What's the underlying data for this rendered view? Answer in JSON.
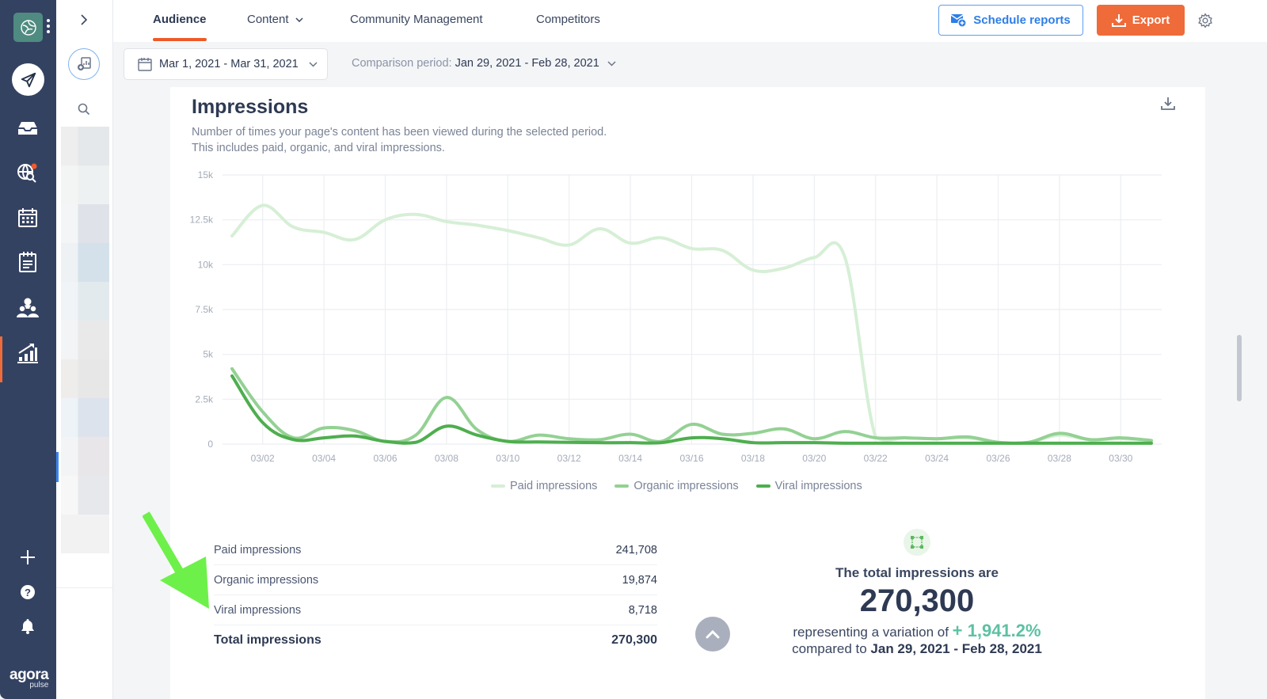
{
  "rail": {
    "brand_line1": "agora",
    "brand_line2": "pulse",
    "items": [
      {
        "name": "publish",
        "icon": "paper-plane-icon"
      },
      {
        "name": "inbox",
        "icon": "inbox-tray-icon"
      },
      {
        "name": "listening",
        "icon": "globe-search-icon",
        "badge_color": "#ef5a2a"
      },
      {
        "name": "calendar",
        "icon": "calendar-icon"
      },
      {
        "name": "reports-list",
        "icon": "notepad-icon"
      },
      {
        "name": "team",
        "icon": "users-icon"
      },
      {
        "name": "analytics",
        "icon": "chart-up-icon",
        "active": true
      }
    ],
    "bottom": [
      {
        "name": "add",
        "icon": "plus-icon"
      },
      {
        "name": "help",
        "icon": "question-icon"
      },
      {
        "name": "notifications",
        "icon": "bell-icon"
      }
    ]
  },
  "panel2": {
    "expand_icon": "chevron-right-icon",
    "report_icon": "add-report-icon",
    "search_icon": "search-icon"
  },
  "tabs": [
    {
      "label": "Audience",
      "active": true
    },
    {
      "label": "Content",
      "dropdown": true
    },
    {
      "label": "Community Management"
    },
    {
      "label": "Competitors"
    }
  ],
  "actions": {
    "schedule_label": "Schedule reports",
    "export_label": "Export",
    "accent_orange": "#ef6b3a",
    "accent_blue": "#2e7ee8"
  },
  "filters": {
    "date_range": "Mar 1, 2021 - Mar 31, 2021",
    "comparison_label": "Comparison period:",
    "comparison_value": "Jan 29, 2021 - Feb 28, 2021"
  },
  "card": {
    "title": "Impressions",
    "desc_line1": "Number of times your page's content has been viewed during the selected period.",
    "desc_line2": "This includes paid, organic, and viral impressions."
  },
  "chart_data": {
    "type": "line",
    "title": "Impressions",
    "xlabel": "",
    "ylabel": "",
    "ylim": [
      0,
      15000
    ],
    "yticks": [
      0,
      2500,
      5000,
      7500,
      10000,
      12500,
      15000
    ],
    "ytick_labels": [
      "0",
      "2.5k",
      "5k",
      "7.5k",
      "10k",
      "12.5k",
      "15k"
    ],
    "x": [
      "03/01",
      "03/02",
      "03/03",
      "03/04",
      "03/05",
      "03/06",
      "03/07",
      "03/08",
      "03/09",
      "03/10",
      "03/11",
      "03/12",
      "03/13",
      "03/14",
      "03/15",
      "03/16",
      "03/17",
      "03/18",
      "03/19",
      "03/20",
      "03/21",
      "03/22",
      "03/23",
      "03/24",
      "03/25",
      "03/26",
      "03/27",
      "03/28",
      "03/29",
      "03/30",
      "03/31"
    ],
    "xtick_labels": [
      "03/02",
      "03/04",
      "03/06",
      "03/08",
      "03/10",
      "03/12",
      "03/14",
      "03/16",
      "03/18",
      "03/20",
      "03/22",
      "03/24",
      "03/26",
      "03/28",
      "03/30"
    ],
    "grid": true,
    "legend_position": "bottom-center",
    "series": [
      {
        "name": "Paid impressions",
        "color": "#d6efd6",
        "values": [
          11600,
          13300,
          12100,
          11800,
          11400,
          12500,
          12800,
          12400,
          12200,
          11900,
          11500,
          11100,
          12000,
          11200,
          11500,
          10900,
          10800,
          9700,
          9800,
          10400,
          10400,
          400,
          350,
          300,
          350,
          100,
          100,
          500,
          250,
          300,
          200
        ]
      },
      {
        "name": "Organic impressions",
        "color": "#93d193",
        "values": [
          4200,
          1800,
          350,
          900,
          750,
          150,
          500,
          2600,
          800,
          150,
          500,
          300,
          250,
          550,
          150,
          1100,
          550,
          600,
          850,
          300,
          700,
          350,
          350,
          300,
          400,
          100,
          100,
          600,
          250,
          350,
          200
        ]
      },
      {
        "name": "Viral impressions",
        "color": "#4eae4e",
        "values": [
          3800,
          1200,
          250,
          350,
          450,
          150,
          100,
          1000,
          500,
          150,
          120,
          100,
          80,
          80,
          80,
          350,
          300,
          80,
          80,
          80,
          50,
          50,
          50,
          50,
          50,
          50,
          50,
          50,
          50,
          50,
          50
        ]
      }
    ]
  },
  "summary": {
    "rows": [
      {
        "label": "Paid impressions",
        "value": "241,708"
      },
      {
        "label": "Organic impressions",
        "value": "19,874"
      },
      {
        "label": "Viral impressions",
        "value": "8,718"
      }
    ],
    "total_label": "Total impressions",
    "total_value": "270,300"
  },
  "total_box": {
    "heading": "The total impressions are",
    "value": "270,300",
    "variation_prefix": "representing a variation of",
    "variation": "+ 1,941.2%",
    "compared_prefix": "compared to",
    "compared_period": "Jan 29, 2021 - Feb 28, 2021",
    "variation_color": "#5cc1a3"
  }
}
